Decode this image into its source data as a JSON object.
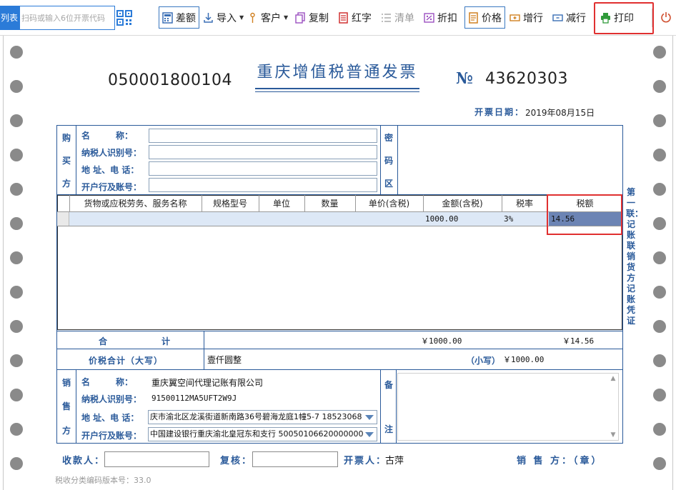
{
  "toolbar": {
    "tab_label": "列表",
    "search_placeholder": "扫码或输入6位开票代码",
    "buttons": {
      "diff_amount": "差额",
      "import": "导入",
      "customer": "客户",
      "copy": "复制",
      "red": "红字",
      "list": "清单",
      "discount": "折扣",
      "price": "价格",
      "add_row": "增行",
      "delete_row": "减行",
      "print": "打印"
    }
  },
  "invoice": {
    "code": "050001800104",
    "title": "重庆增值税普通发票",
    "number_prefix": "№",
    "number": "43620303",
    "date_label": "开票日期：",
    "date": "2019年08月15日",
    "buyer": {
      "side_label": [
        "购",
        "买",
        "方"
      ],
      "name_label": "名　　　称：",
      "tax_id_label": "纳税人识别号：",
      "address_label": "地 址、电 话：",
      "bank_label": "开户行及账号：",
      "name": "",
      "tax_id": "",
      "address": "",
      "bank": ""
    },
    "cipher_label": [
      "密",
      "码",
      "区"
    ],
    "items_table": {
      "headers": [
        "货物或应税劳务、服务名称",
        "规格型号",
        "单位",
        "数量",
        "单价(含税)",
        "金额(含税)",
        "税率",
        "税额"
      ],
      "rows": [
        {
          "name": "",
          "spec": "",
          "unit": "",
          "qty": "",
          "price": "",
          "amount": "1000.00",
          "rate": "3%",
          "tax": "14.56"
        }
      ]
    },
    "copy_label": "第一联：记账联　销货方记账凭证",
    "total_label": "合　　　计",
    "total_amount": "￥1000.00",
    "total_tax": "￥14.56",
    "grand_total_label": "价税合计（大写）",
    "grand_total_words": "壹仟圆整",
    "small_label": "（小写）",
    "grand_total_figure": "￥1000.00",
    "seller": {
      "side_label": [
        "销",
        "售",
        "方"
      ],
      "name_label": "名　　　称：",
      "tax_id_label": "纳税人识别号：",
      "address_label": "地 址、电 话：",
      "bank_label": "开户行及账号：",
      "name": "重庆翼空间代理记账有限公司",
      "tax_id": "91500112MA5UFT2W9J",
      "address": "庆市渝北区龙溪街道新南路36号碧海龙庭1幢5-7 18523068",
      "bank": "中国建设银行重庆渝北皇冠东和支行 50050106620000000"
    },
    "remarks_label": [
      "备",
      "注"
    ],
    "payee_label": "收款人：",
    "reviewer_label": "复核：",
    "issuer_label": "开票人：",
    "issuer": "古萍",
    "seller_stamp_label": "销 售 方：（章）",
    "version_note": "税收分类编码版本号：33.0"
  }
}
